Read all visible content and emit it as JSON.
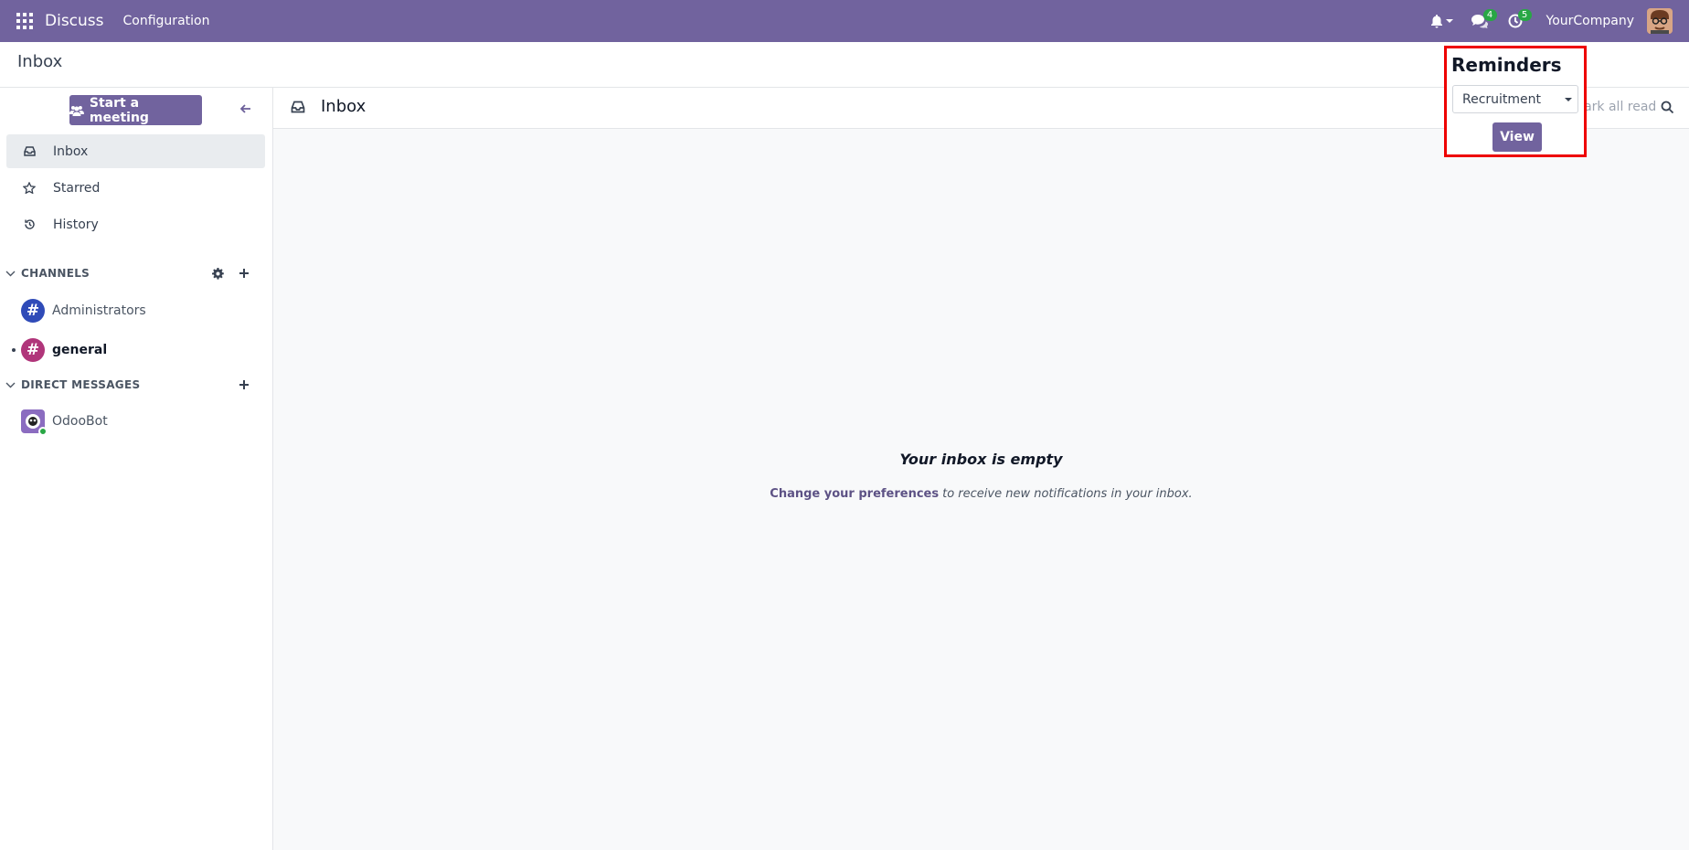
{
  "navbar": {
    "app_name": "Discuss",
    "menu_configuration": "Configuration",
    "chat_badge": "4",
    "activity_badge": "5",
    "company": "YourCompany",
    "bg_color": "#71639e"
  },
  "control_panel": {
    "breadcrumb": "Inbox"
  },
  "sidebar": {
    "start_meeting": "Start a meeting",
    "items": [
      {
        "label": "Inbox",
        "icon": "inbox-icon"
      },
      {
        "label": "Starred",
        "icon": "star-icon"
      },
      {
        "label": "History",
        "icon": "history-icon"
      }
    ],
    "channels_header": "CHANNELS",
    "channels": [
      {
        "name": "Administrators",
        "color": "#2f4bb8"
      },
      {
        "name": "general",
        "color": "#b0357a"
      }
    ],
    "dm_header": "DIRECT MESSAGES",
    "direct_messages": [
      {
        "name": "OdooBot"
      }
    ]
  },
  "main": {
    "title": "Inbox",
    "mark_all_read": "Mark all read",
    "empty_title": "Your inbox is empty",
    "empty_link": "Change your preferences",
    "empty_rest": "to receive new notifications in your inbox."
  },
  "reminders": {
    "title": "Reminders",
    "selected": "Recruitment",
    "view_label": "View"
  }
}
